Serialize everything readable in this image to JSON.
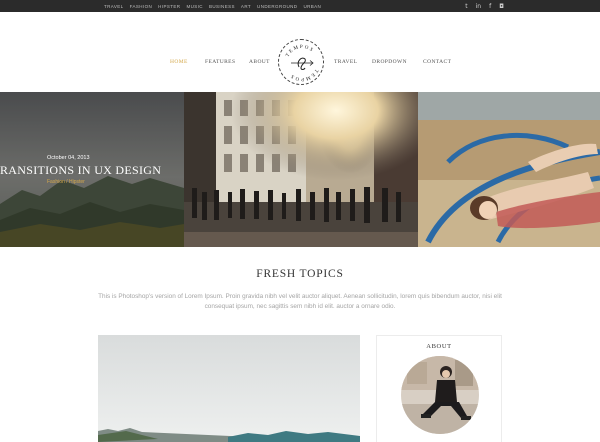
{
  "topbar": {
    "links": [
      "TRAVEL",
      "FASHION",
      "HIPSTER",
      "MUSIC",
      "BUSINESS",
      "ART",
      "UNDERGROUND",
      "URBAN"
    ],
    "social_icons": [
      "twitter-icon",
      "linkedin-icon",
      "facebook-icon",
      "instagram-icon"
    ],
    "social_glyphs": [
      "t",
      "in",
      "f",
      "◘"
    ]
  },
  "nav": {
    "home": "HOME",
    "features": "FEATURES",
    "about": "ABOUT",
    "travel": "TRAVEL",
    "dropdown": "DROPDOWN",
    "contact": "CONTACT"
  },
  "logo": {
    "text_top": "TEMPOS",
    "text_bottom": "TEMPOS"
  },
  "hero": {
    "date": "October 04, 2013",
    "title": "RANSITIONS IN UX DESIGN",
    "category_a": "Fashion",
    "category_sep": " / ",
    "category_b": "Hipster"
  },
  "section": {
    "title": "FRESH TOPICS",
    "intro": "This is Photoshop's version of Lorem Ipsum. Proin gravida nibh vel velit auctor aliquet. Aenean sollicitudin, lorem quis bibendum auctor, nisi elit consequat ipsum, nec sagittis sem nibh id elit. auctor a ornare odio."
  },
  "sidebar": {
    "about_title": "ABOUT"
  },
  "colors": {
    "accent": "#d4a84b",
    "topbar": "#2b2b2b",
    "text": "#333333",
    "muted": "#a5a5a5"
  }
}
